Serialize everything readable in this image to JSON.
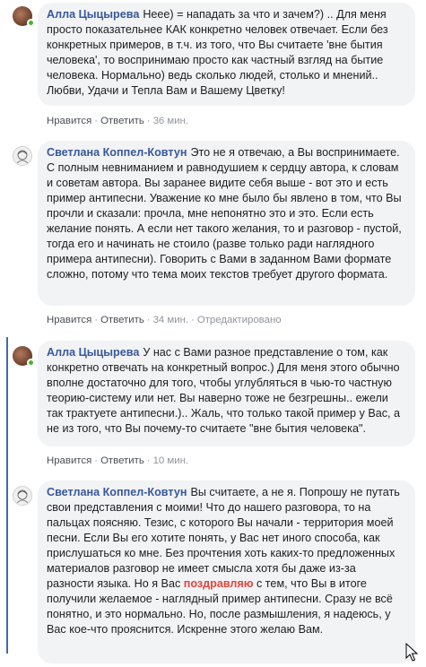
{
  "comments": [
    {
      "author": "Алла Цыцырева",
      "text": "Неее) = нападать за что и зачем?) .. Для меня просто показательнее КАК конкретно человек отвечает. Если без конкретных примеров, в т.ч. из того, что Вы считаете 'вне бытия человека', то воспринимаю просто как частный взгляд на бытие человека. Нормально) ведь сколько людей, столько и мнений.. Любви, Удачи и Тепла Вам и Вашему Цветку!",
      "like": "Нравится",
      "reply": "Ответить",
      "time": "36 мин."
    },
    {
      "author": "Светлана Коппел-Ковтун",
      "text": "Это не я отвечаю, а Вы воспринимаете. С полным невниманием и равнодушием к сердцу автора, к словам и советам автора. Вы заранее видите себя выше - вот это и есть пример антипесни. Уважение ко мне было бы явлено в том, что Вы прочли и сказали: прочла, мне непонятно это и это. Если есть желание понять. А если нет такого желания, то и разговор - пустой, тогда его и начинать не стоило (разве только ради наглядного примера антипесни). Говорить с Вами в заданном Вами формате сложно, потому что тема моих текстов требует другого формата.",
      "like": "Нравится",
      "reply": "Ответить",
      "time": "34 мин.",
      "edited": "Отредактировано"
    },
    {
      "author": "Алла Цыцырева",
      "text": "У нас с Вами разное представление о том, как конкретно отвечать на конкретный вопрос.) Для меня этого обычно вполне достаточно для того, чтобы углубляться в чью-то частную теорию-систему или нет. Вы наверно тоже не безгрешны.. ежели так трактуете антипесни.).. Жаль, что только такой пример у Вас, а не из того, что Вы почему-то считаете \"вне бытия человека\".",
      "like": "Нравится",
      "reply": "Ответить",
      "time": "10 мин."
    },
    {
      "author": "Светлана Коппел-Ковтун",
      "text_before": "Вы считаете, а не я. Попрошу не путать свои представления с моими! Что до нашего разговора, то на пальцах поясняю. Тезис, с которого Вы начали - территория моей песни. Если Вы его хотите понять, у Вас нет иного способа, как прислушаться ко мне. Без прочтения хоть каких-то предложенных материалов разговор не имеет смысла хотя бы даже из-за разности языка. Но я Вас ",
      "highlight": "поздравляю",
      "text_after": " с тем, что Вы в итоге получили желаемое - наглядный пример антипесни. Сразу не всё понятно, и это нормально. Но, после размышления, я надеюсь, у Вас кое-что прояснится. Искренне этого желаю Вам."
    }
  ],
  "colors": {
    "author": "#385898",
    "bubble": "#f2f3f5",
    "highlight": "#e2453c",
    "online": "#42b72a",
    "thread_bar": "#4267b2"
  }
}
